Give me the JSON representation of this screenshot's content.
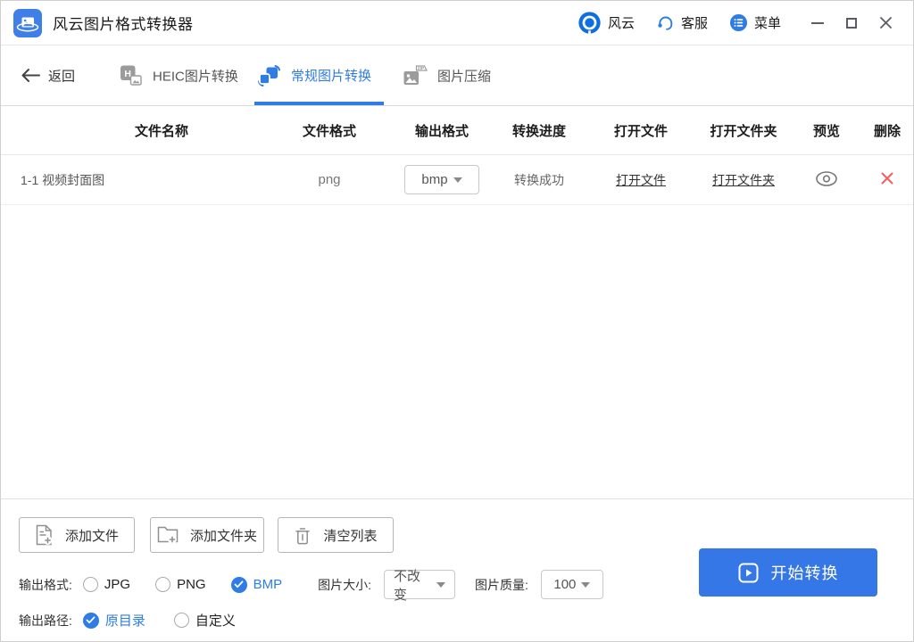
{
  "app": {
    "title": "风云图片格式转换器"
  },
  "titlebar": {
    "brand_label": "风云",
    "support_label": "客服",
    "menu_label": "菜单"
  },
  "nav": {
    "back_label": "返回",
    "tabs": [
      {
        "label": "HEIC图片转换",
        "active": false
      },
      {
        "label": "常规图片转换",
        "active": true
      },
      {
        "label": "图片压缩",
        "active": false
      }
    ]
  },
  "table": {
    "headers": [
      "文件名称",
      "文件格式",
      "输出格式",
      "转换进度",
      "打开文件",
      "打开文件夹",
      "预览",
      "删除"
    ],
    "rows": [
      {
        "name": "1-1 视频封面图",
        "source_format": "png",
        "output_format": "bmp",
        "progress": "转换成功",
        "open_file_label": "打开文件",
        "open_folder_label": "打开文件夹"
      }
    ]
  },
  "toolbar": {
    "add_file_label": "添加文件",
    "add_folder_label": "添加文件夹",
    "clear_list_label": "清空列表"
  },
  "settings": {
    "output_format_label": "输出格式:",
    "format_options": [
      {
        "label": "JPG",
        "checked": false
      },
      {
        "label": "PNG",
        "checked": false
      },
      {
        "label": "BMP",
        "checked": true
      }
    ],
    "image_size_label": "图片大小:",
    "image_size_value": "不改变",
    "image_quality_label": "图片质量:",
    "image_quality_value": "100",
    "output_path_label": "输出路径:",
    "path_options": [
      {
        "label": "原目录",
        "checked": true
      },
      {
        "label": "自定义",
        "checked": false
      }
    ]
  },
  "start_button_label": "开始转换",
  "colors": {
    "accent": "#2e7ce4",
    "danger": "#f0605a",
    "start_button": "#3577e6"
  }
}
